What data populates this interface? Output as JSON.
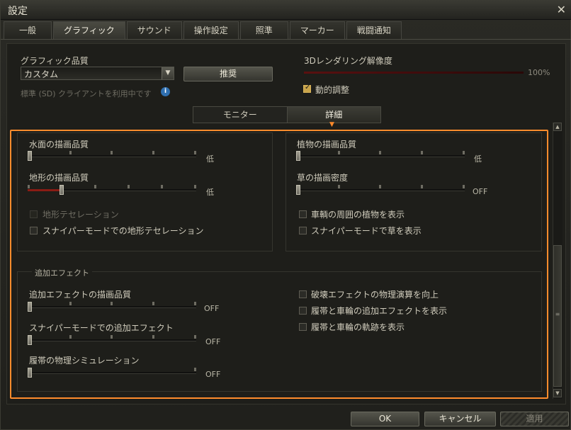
{
  "window": {
    "title": "設定"
  },
  "tabs": [
    {
      "label": "一般"
    },
    {
      "label": "グラフィック"
    },
    {
      "label": "サウンド"
    },
    {
      "label": "操作設定"
    },
    {
      "label": "照準"
    },
    {
      "label": "マーカー"
    },
    {
      "label": "戦闘通知"
    }
  ],
  "graphics": {
    "quality_label": "グラフィック品質",
    "quality_value": "カスタム",
    "recommend_button": "推奨",
    "sd_note": "標準 (SD) クライアントを利用中です",
    "resolution_label": "3Dレンダリング解像度",
    "resolution_value": "100%",
    "resolution_fraction": 1.0,
    "dynamic_label": "動的調整",
    "dynamic_checked": true
  },
  "subtabs": [
    {
      "label": "モニター"
    },
    {
      "label": "詳細"
    }
  ],
  "detail": {
    "water_label": "水面の描画品質",
    "water_value": "低",
    "terrain_label": "地形の描画品質",
    "terrain_value": "低",
    "tessellation_label": "地形テセレーション",
    "sniper_tessellation_label": "スナイパーモードでの地形テセレーション",
    "vegetation_label": "植物の描画品質",
    "vegetation_value": "低",
    "grass_label": "草の描画密度",
    "grass_value": "OFF",
    "vehicle_vegetation_label": "車輌の周囲の植物を表示",
    "sniper_grass_label": "スナイパーモードで草を表示"
  },
  "effects": {
    "section_title": "追加エフェクト",
    "quality_label": "追加エフェクトの描画品質",
    "quality_value": "OFF",
    "sniper_label": "スナイパーモードでの追加エフェクト",
    "sniper_value": "OFF",
    "track_label": "履帯の物理シミュレーション",
    "track_value": "OFF",
    "physics_label": "破壊エフェクトの物理演算を向上",
    "track_effects_label": "履帯と車輪の追加エフェクトを表示",
    "track_marks_label": "履帯と車輪の軌跡を表示"
  },
  "footer": {
    "ok": "OK",
    "cancel": "キャンセル",
    "apply": "適用"
  }
}
